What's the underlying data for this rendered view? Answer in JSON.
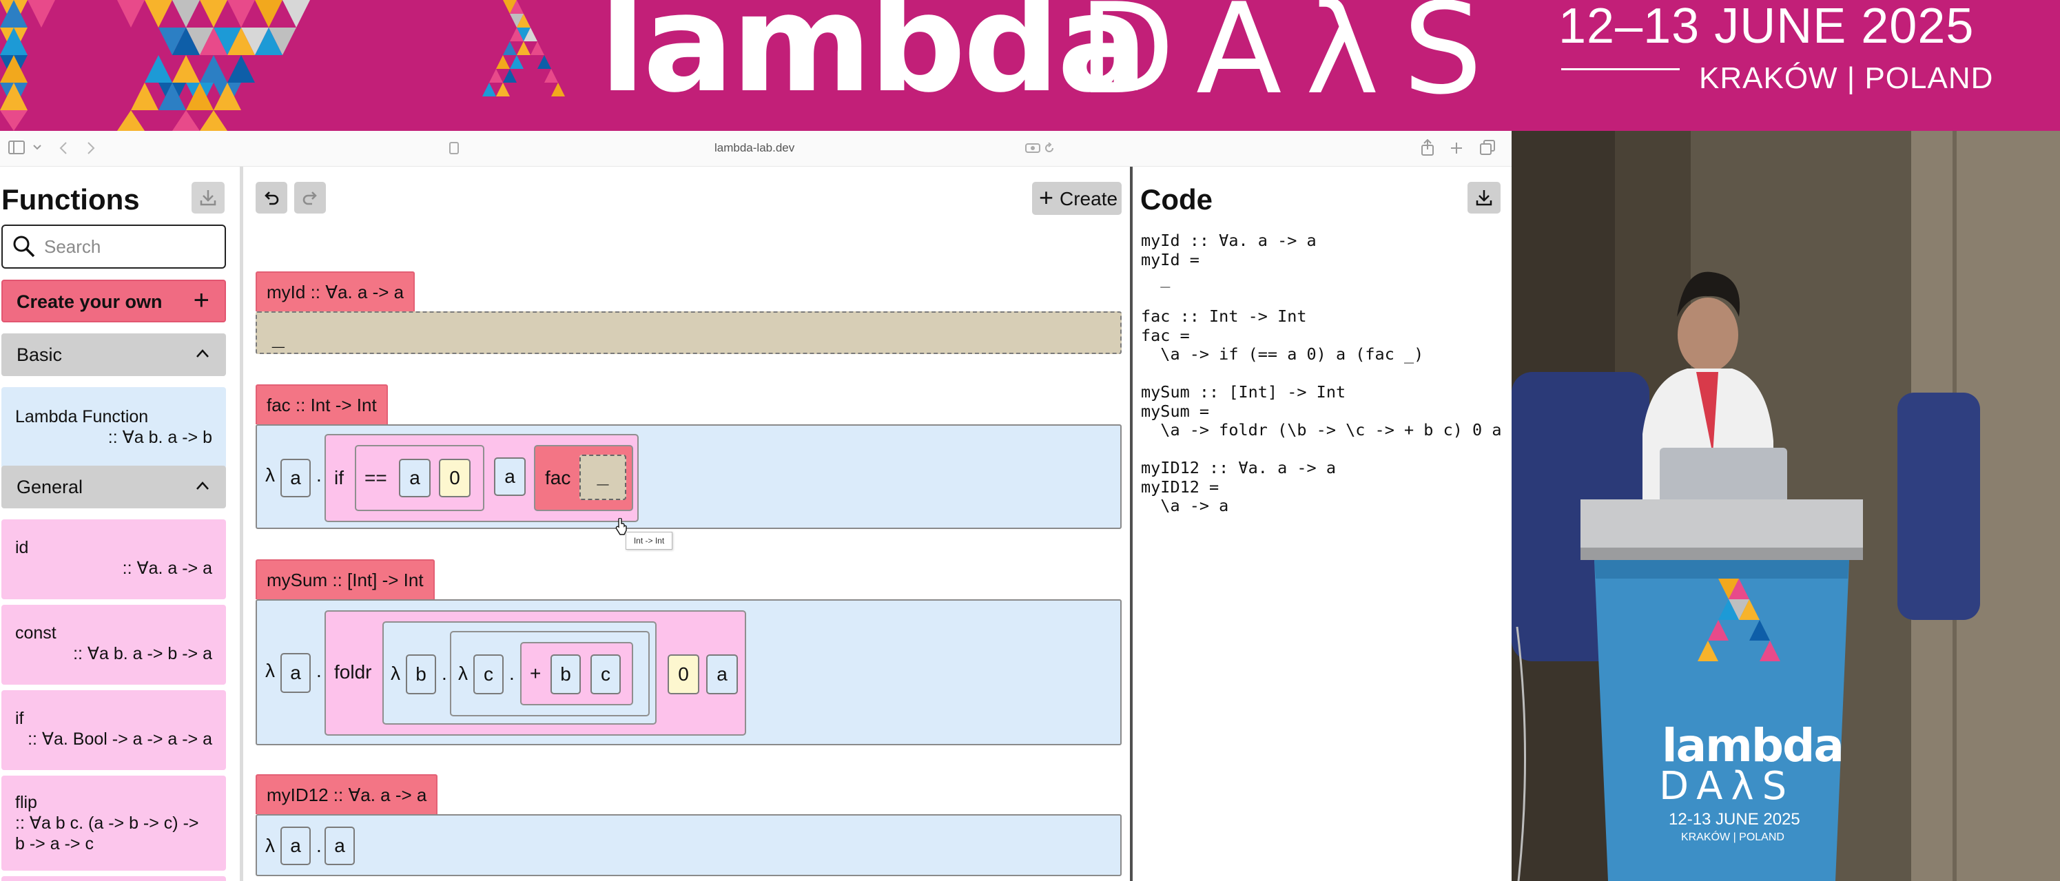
{
  "banner": {
    "brand_bold": "lambda",
    "brand_light": "DAλS",
    "date": "12–13 JUNE 2025",
    "place": "KRAKÓW | POLAND",
    "colors": {
      "background": "#c21f78",
      "text": "#ffffff"
    }
  },
  "browser": {
    "url": "lambda-lab.dev",
    "icons": [
      "sidebar-toggle-icon",
      "chevron-down-icon",
      "back-icon",
      "forward-icon",
      "page-icon",
      "reader-icon",
      "reload-icon",
      "share-icon",
      "new-tab-icon",
      "tab-overview-icon"
    ]
  },
  "sidebar": {
    "title": "Functions",
    "search_placeholder": "Search",
    "create_label": "Create your own",
    "create_icon": "plus-icon",
    "sections": [
      {
        "label": "Basic",
        "expanded": true
      },
      {
        "label": "General",
        "expanded": true
      }
    ],
    "basic_items": [
      {
        "name": "Lambda Function",
        "type": ":: ∀a b. a -> b"
      }
    ],
    "general_items": [
      {
        "name": "id",
        "type": ":: ∀a. a -> a"
      },
      {
        "name": "const",
        "type": ":: ∀a b. a -> b -> a"
      },
      {
        "name": "if",
        "type": ":: ∀a. Bool -> a -> a -> a"
      },
      {
        "name": "flip",
        "type": ":: ∀a b c. (a -> b -> c) -> b -> a -> c"
      }
    ],
    "colors": {
      "create": "#f06b82",
      "section": "#cfcfcf",
      "lambda_item": "#dbebfa",
      "function_item": "#fcc6ec"
    }
  },
  "editor": {
    "undo_icon": "undo-icon",
    "redo_icon": "redo-icon",
    "create_label": "Create",
    "defs": [
      {
        "label": "myId :: ∀a. a -> a",
        "hole": "_"
      },
      {
        "label": "fac :: Int -> Int",
        "lambda": "λ",
        "param": "a",
        "dot": ".",
        "if": "if",
        "eq": "==",
        "a1": "a",
        "zero": "0",
        "a2": "a",
        "fac": "fac",
        "hole": "_",
        "tooltip": "Int -> Int"
      },
      {
        "label": "mySum :: [Int] -> Int",
        "lambda": "λ",
        "param": "a",
        "dot": ".",
        "foldr": "foldr",
        "lambda_b": "λ",
        "b": "b",
        "dot_b": ".",
        "lambda_c": "λ",
        "c": "c",
        "dot_c": ".",
        "plus": "+",
        "b2": "b",
        "c2": "c",
        "zero": "0",
        "a2": "a"
      },
      {
        "label": "myID12 :: ∀a. a -> a",
        "lambda": "λ",
        "param": "a",
        "dot": ".",
        "body": "a"
      }
    ],
    "colors": {
      "def_label": "#f37585",
      "def_body": "#dbebfa",
      "hole": "#d7ceb6",
      "app": "#fdc2eb",
      "literal": "#fdf7cf"
    }
  },
  "code": {
    "title": "Code",
    "download_icon": "download-icon",
    "text": "myId :: ∀a. a -> a\nmyId =\n  _\n\nfac :: Int -> Int\nfac =\n  \\a -> if (== a 0) a (fac _)\n\nmySum :: [Int] -> Int\nmySum =\n  \\a -> foldr (\\b -> \\c -> + b c) 0 a\n\nmyID12 :: ∀a. a -> a\nmyID12 =\n  \\a -> a"
  },
  "stage": {
    "lectern_bold": "lambda",
    "lectern_light": "DAλS",
    "lectern_date": "12-13 JUNE 2025",
    "lectern_place": "KRAKÓW | POLAND"
  }
}
